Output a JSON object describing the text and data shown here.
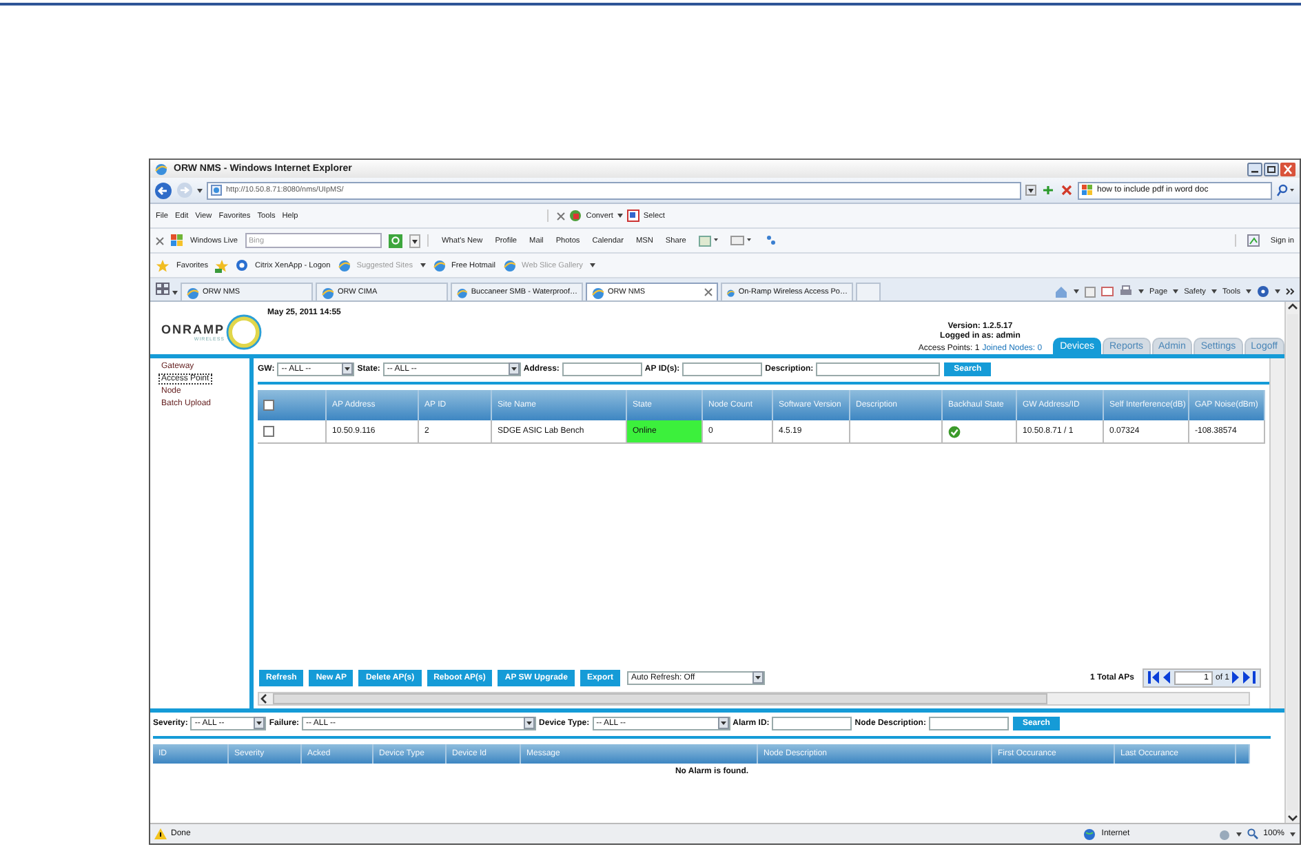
{
  "browser": {
    "title": "ORW NMS - Windows Internet Explorer",
    "address": "http://10.50.8.71:8080/nms/UIpMS/",
    "search": "how to include pdf in word doc",
    "menu": [
      "File",
      "Edit",
      "View",
      "Favorites",
      "Tools",
      "Help"
    ],
    "menu_tools": [
      "Convert",
      "Select"
    ],
    "live_label": "Windows Live",
    "live_placeholder": "Bing",
    "live_links": [
      "What's New",
      "Profile",
      "Mail",
      "Photos",
      "Calendar",
      "MSN",
      "Share"
    ],
    "sign_in": "Sign in",
    "favorites_label": "Favorites",
    "favorites": [
      {
        "label": "Citrix XenApp - Logon",
        "disabled": false,
        "dropdown": false
      },
      {
        "label": "Suggested Sites",
        "disabled": true,
        "dropdown": true
      },
      {
        "label": "Free Hotmail",
        "disabled": false,
        "dropdown": false
      },
      {
        "label": "Web Slice Gallery",
        "disabled": true,
        "dropdown": true
      }
    ],
    "tabs": [
      {
        "label": "ORW NMS",
        "selected": false
      },
      {
        "label": "ORW CIMA",
        "selected": false
      },
      {
        "label": "Buccaneer SMB - Waterproof…",
        "selected": false
      },
      {
        "label": "ORW NMS",
        "selected": true
      },
      {
        "label": "On-Ramp Wireless Access Po…",
        "selected": false
      }
    ],
    "command_bar": [
      "Page",
      "Safety",
      "Tools"
    ],
    "status": "Done",
    "zone": "Internet",
    "zoom": "100%"
  },
  "app": {
    "logo": "ONRAMP",
    "logo_sub": "WIRELESS",
    "date": "May 25, 2011 14:55",
    "version": "Version: 1.2.5.17",
    "logged_in": "Logged in as: admin",
    "access_points": "Access Points: 1",
    "joined_nodes": "Joined Nodes: 0",
    "nav_tabs": [
      {
        "label": "Devices",
        "selected": true
      },
      {
        "label": "Reports",
        "selected": false
      },
      {
        "label": "Admin",
        "selected": false
      },
      {
        "label": "Settings",
        "selected": false
      },
      {
        "label": "Logoff",
        "selected": false
      }
    ],
    "sidebar": [
      {
        "label": "Gateway",
        "selected": false
      },
      {
        "label": "Access Point",
        "selected": true
      },
      {
        "label": "Node",
        "selected": false
      },
      {
        "label": "Batch Upload",
        "selected": false
      }
    ],
    "filters": [
      {
        "label": "GW:",
        "kind": "select",
        "value": "-- ALL --"
      },
      {
        "label": "State:",
        "kind": "select",
        "value": "-- ALL --"
      },
      {
        "label": "Address:",
        "kind": "input"
      },
      {
        "label": "AP ID(s):",
        "kind": "input"
      },
      {
        "label": "Description:",
        "kind": "input"
      }
    ],
    "search_button": "Search",
    "table": {
      "select_all_checked": false,
      "columns": [
        "AP Address",
        "AP ID",
        "Site Name",
        "State",
        "Node Count",
        "Software Version",
        "Description",
        "Backhaul State",
        "GW Address/ID",
        "Self Interference(dB)",
        "GAP Noise(dBm)"
      ],
      "rows": [
        {
          "checked": false,
          "ap_address": "10.50.9.116",
          "ap_id": "2",
          "site_name": "SDGE ASIC Lab Bench",
          "state": "Online",
          "online": true,
          "node_count": "0",
          "software_version": "4.5.19",
          "backhaul_ok": true,
          "gw_address": "10.50.8.71 / 1",
          "self_interference": "0.07324",
          "gap_noise": "-108.38574"
        }
      ]
    },
    "buttons": [
      "Refresh",
      "New AP",
      "Delete AP(s)",
      "Reboot AP(s)",
      "AP SW Upgrade",
      "Export"
    ],
    "auto_refresh": "Auto Refresh: Off",
    "total": "1 Total APs",
    "page": "1",
    "page_of": "of 1",
    "alarm_filters": [
      {
        "label": "Severity:",
        "kind": "select",
        "value": "-- ALL --"
      },
      {
        "label": "Failure:",
        "kind": "select",
        "value": "-- ALL --"
      },
      {
        "label": "Device Type:",
        "kind": "select",
        "value": "-- ALL --"
      },
      {
        "label": "Alarm ID:",
        "kind": "input"
      },
      {
        "label": "Node Description:",
        "kind": "input"
      }
    ],
    "alarm_search": "Search",
    "alarm_columns": [
      "ID",
      "Severity",
      "Acked",
      "Device Type",
      "Device Id",
      "Message",
      "Node Description",
      "First Occurance",
      "Last Occurance"
    ],
    "alarm_empty": "No Alarm is found."
  }
}
